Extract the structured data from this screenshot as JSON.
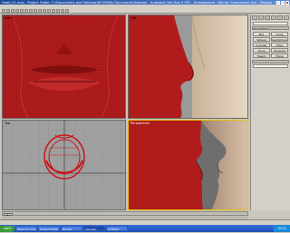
{
  "window": {
    "title": "Head_01.max - Project Folder: C:\\Documents and Settings\\BOOM\\My Documents\\3dsmax - Autodesk 3ds Max 9 SP2 - Unregistered - Not for Commercial Use - Display : Direct 3D",
    "controls": [
      "minimize",
      "maximize",
      "close"
    ]
  },
  "viewports": {
    "front": "Front",
    "left": "Left",
    "top": "Top",
    "perspective": "Perspective"
  },
  "command_panel": {
    "tabs": [
      "create-icon",
      "modify-icon",
      "hierarchy-icon",
      "motion-icon",
      "display-icon",
      "utilities-icon"
    ],
    "rollout_title": "Object Type",
    "buttons": [
      "Box",
      "Cone",
      "Sphere",
      "GeoSphere",
      "Cylinder",
      "Tube",
      "Torus",
      "Pyramid",
      "Teapot",
      "Plane"
    ]
  },
  "time_slider": {
    "frame_label": "0 / 100"
  },
  "taskbar": {
    "start_label": "start",
    "tasks": [
      "Head_01.max",
      "Project Folder",
      "Render",
      "3ds Max",
      "Untitled"
    ],
    "active_task": 3,
    "clock": "10:42"
  },
  "colors": {
    "model": "#b01c1c",
    "active_viewport_border": "#e6c200",
    "taskbar": "#2a5ac8"
  }
}
